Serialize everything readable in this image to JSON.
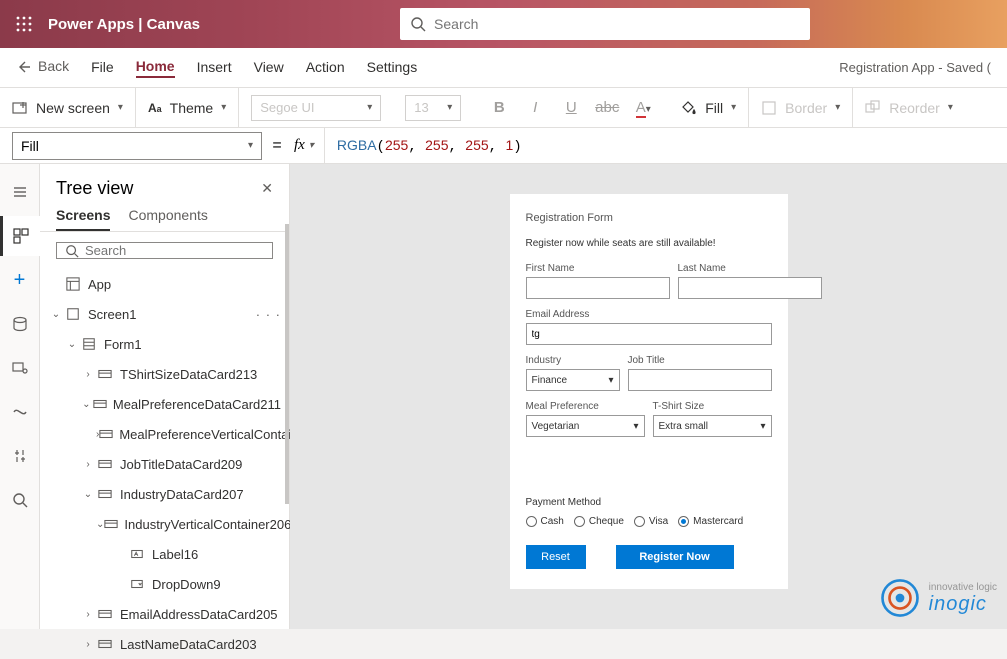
{
  "header": {
    "product": "Power Apps  |  Canvas",
    "search_placeholder": "Search"
  },
  "menu": {
    "back": "Back",
    "items": [
      "File",
      "Home",
      "Insert",
      "View",
      "Action",
      "Settings"
    ],
    "active": "Home",
    "status": "Registration App - Saved ("
  },
  "toolbar": {
    "newscreen": "New screen",
    "theme": "Theme",
    "font": "Segoe UI",
    "size": "13",
    "fill": "Fill",
    "border": "Border",
    "reorder": "Reorder"
  },
  "formula": {
    "property": "Fill",
    "fn": "RGBA",
    "args": [
      "255",
      "255",
      "255",
      "1"
    ]
  },
  "panel": {
    "title": "Tree view",
    "tabs": [
      "Screens",
      "Components"
    ],
    "search_placeholder": "Search",
    "tree": [
      {
        "depth": 0,
        "twist": "",
        "icon": "layout",
        "label": "App"
      },
      {
        "depth": 0,
        "twist": "v",
        "icon": "screen",
        "label": "Screen1",
        "dots": true
      },
      {
        "depth": 1,
        "twist": "v",
        "icon": "form",
        "label": "Form1"
      },
      {
        "depth": 2,
        "twist": ">",
        "icon": "card",
        "label": "TShirtSizeDataCard213"
      },
      {
        "depth": 2,
        "twist": "v",
        "icon": "card",
        "label": "MealPreferenceDataCard211"
      },
      {
        "depth": 3,
        "twist": ">",
        "icon": "card",
        "label": "MealPreferenceVerticalContainer"
      },
      {
        "depth": 2,
        "twist": ">",
        "icon": "card",
        "label": "JobTitleDataCard209"
      },
      {
        "depth": 2,
        "twist": "v",
        "icon": "card",
        "label": "IndustryDataCard207"
      },
      {
        "depth": 3,
        "twist": "v",
        "icon": "card",
        "label": "IndustryVerticalContainer206"
      },
      {
        "depth": 4,
        "twist": "",
        "icon": "label",
        "label": "Label16"
      },
      {
        "depth": 4,
        "twist": "",
        "icon": "dropdown",
        "label": "DropDown9"
      },
      {
        "depth": 2,
        "twist": ">",
        "icon": "card",
        "label": "EmailAddressDataCard205"
      },
      {
        "depth": 2,
        "twist": ">",
        "icon": "card",
        "label": "LastNameDataCard203"
      }
    ]
  },
  "form": {
    "title": "Registration Form",
    "subtitle": "Register now while seats are still available!",
    "first_name": "First Name",
    "last_name": "Last Name",
    "email": "Email Address",
    "email_val": "tg",
    "industry": "Industry",
    "industry_val": "Finance",
    "job": "Job Title",
    "meal": "Meal Preference",
    "meal_val": "Vegetarian",
    "tshirt": "T-Shirt Size",
    "tshirt_val": "Extra small",
    "payment": "Payment Method",
    "opts": [
      "Cash",
      "Cheque",
      "Visa",
      "Mastercard"
    ],
    "selected": "Mastercard",
    "reset": "Reset",
    "register": "Register Now"
  },
  "logo": {
    "tag": "innovative logic",
    "brand": "inogic"
  }
}
